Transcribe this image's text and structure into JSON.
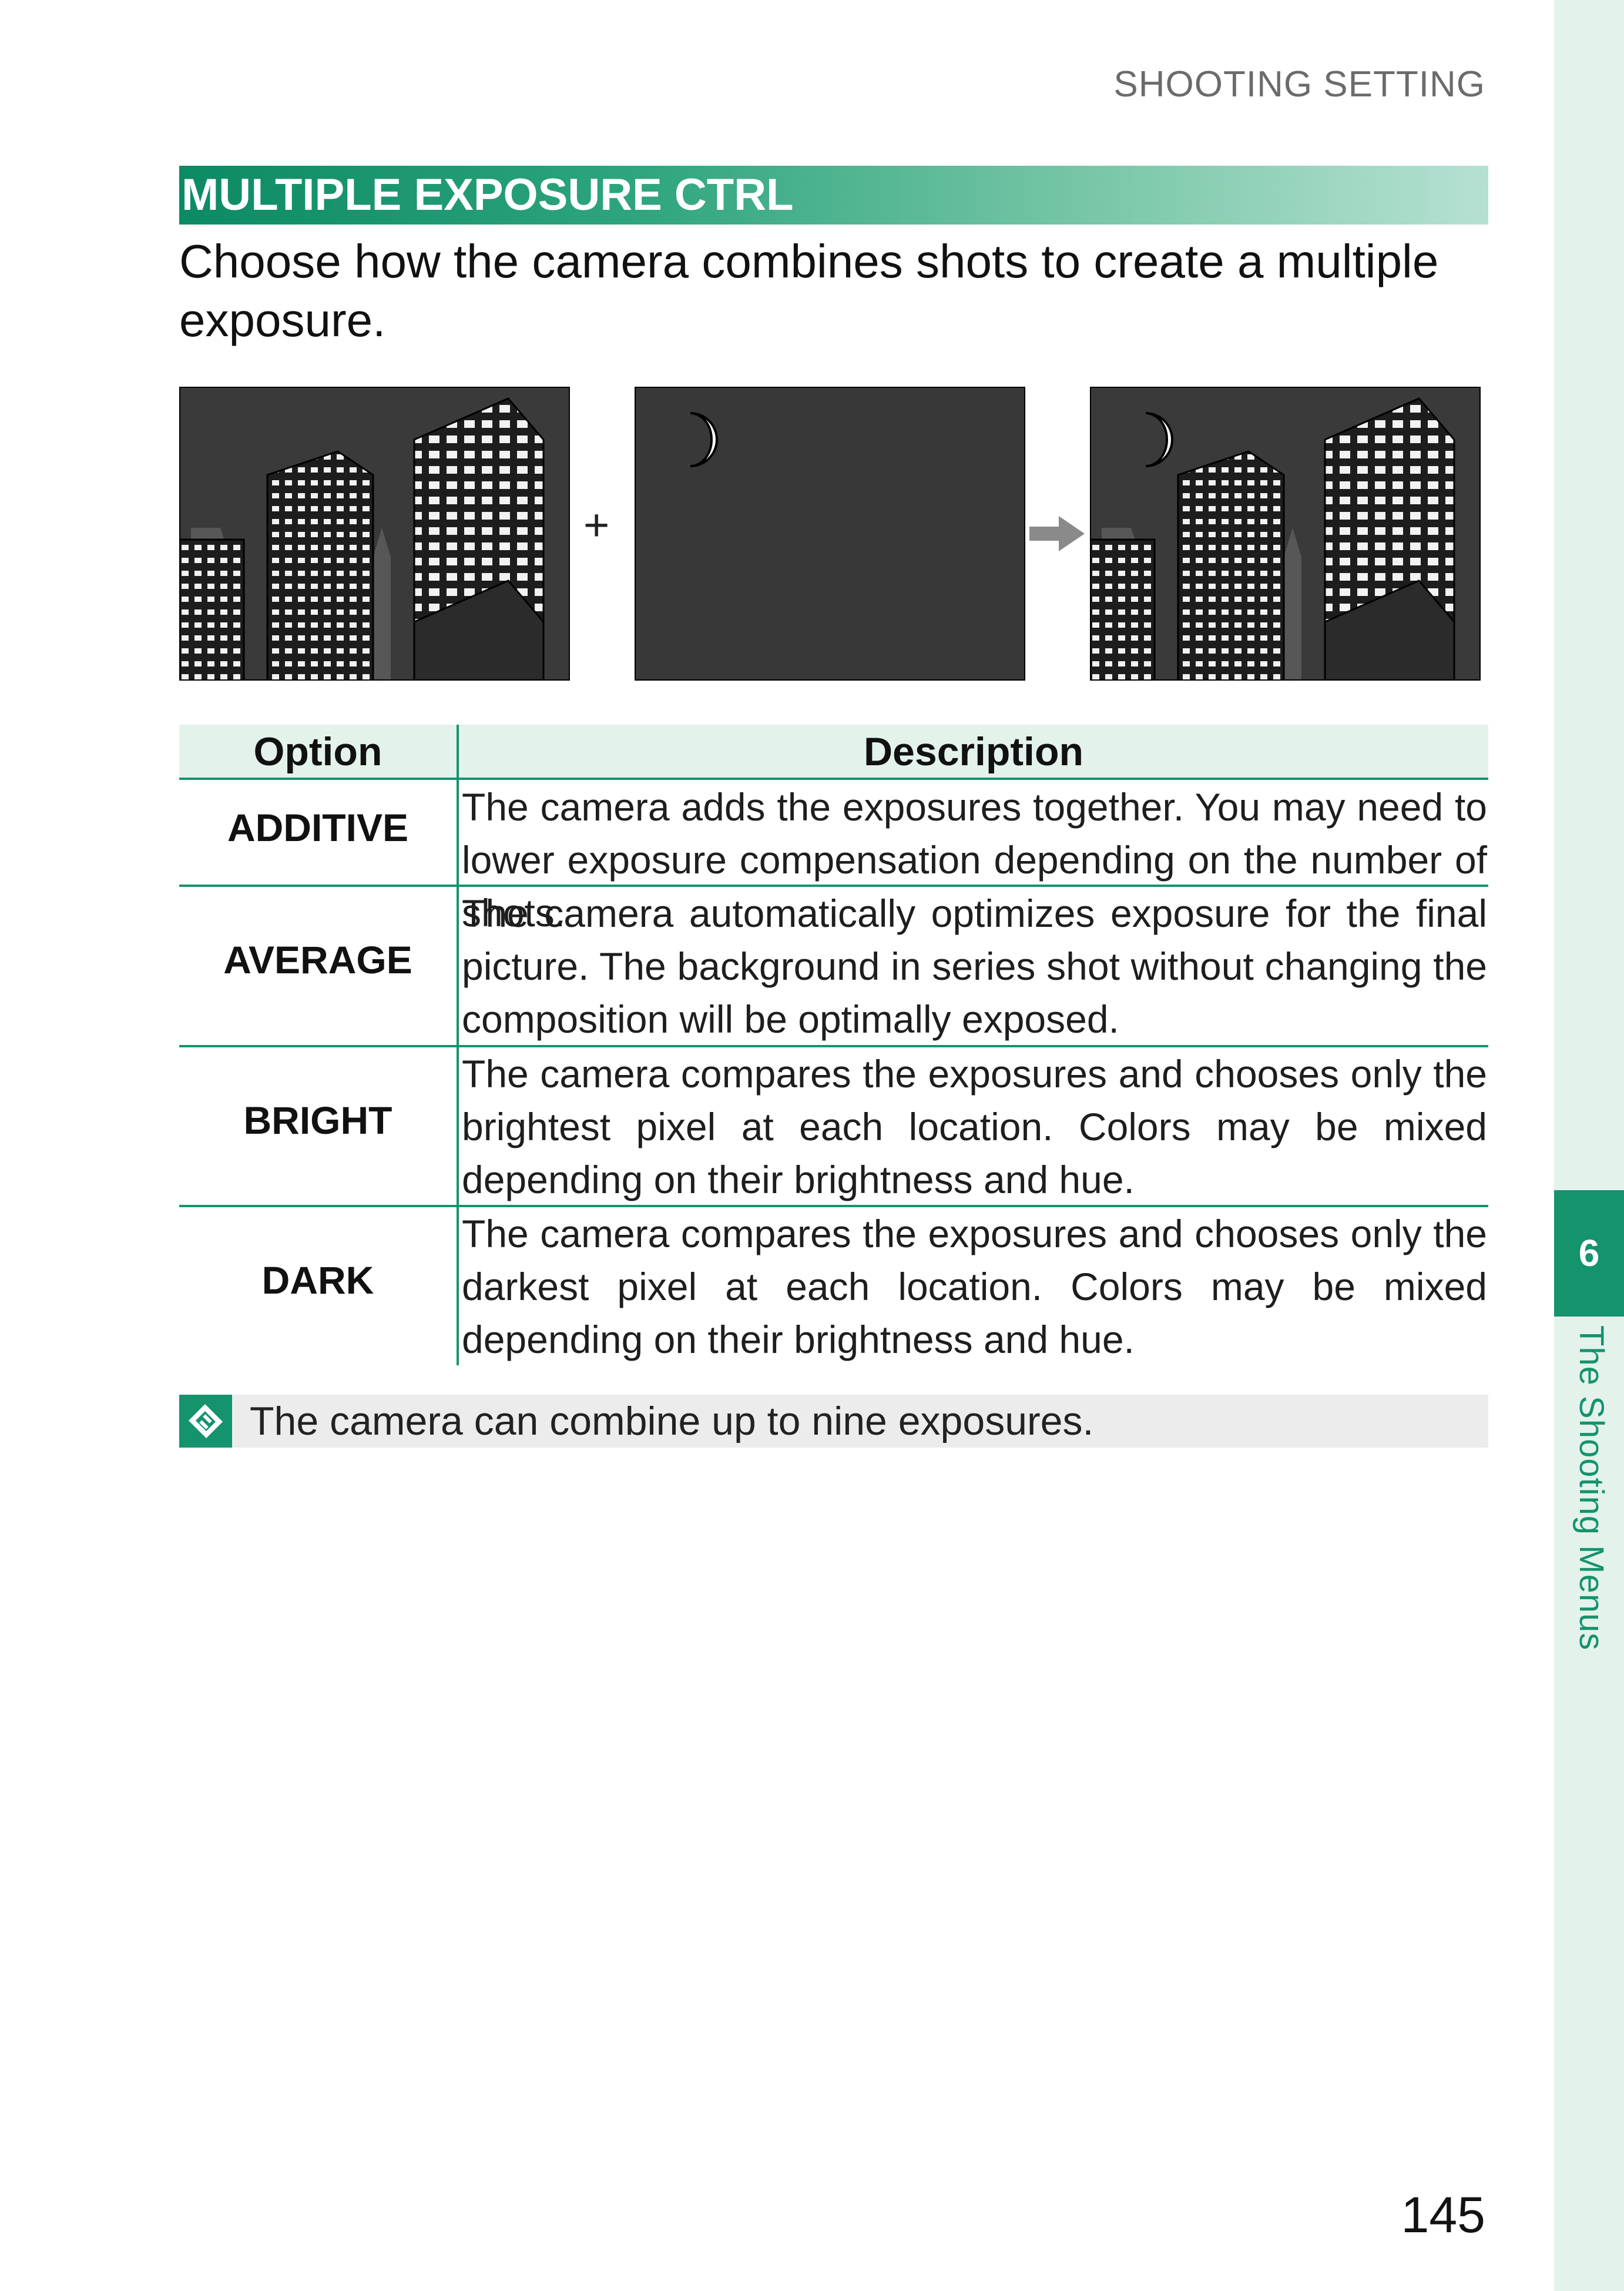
{
  "header": {
    "section": "SHOOTING SETTING"
  },
  "heading": {
    "title": "MULTIPLE EXPOSURE CTRL"
  },
  "intro": {
    "text": "Choose how the camera combines shots to create a multiple exposure."
  },
  "illustration": {
    "plus": "+",
    "icons": [
      "city-skyline-image",
      "moon-night-image",
      "arrow-right-icon",
      "combined-exposure-image"
    ]
  },
  "table": {
    "headers": {
      "option": "Option",
      "description": "Description"
    },
    "rows": [
      {
        "option": "ADDITIVE",
        "description": "The camera adds the exposures together. You may need to lower exposure compensation depending on the number of shots."
      },
      {
        "option": "AVERAGE",
        "description": "The camera automatically optimizes exposure for the final picture. The background in series shot without changing the composition will be optimally exposed."
      },
      {
        "option": "BRIGHT",
        "description": "The camera compares the exposures and chooses only the brightest pixel at each location. Colors may be mixed depending on their brightness and hue."
      },
      {
        "option": "DARK",
        "description": "The camera compares the exposures and chooses only the darkest pixel at each location. Colors may be mixed depending on their brightness and hue."
      }
    ]
  },
  "note": {
    "icon": "note-icon",
    "text": "The camera can combine up to nine exposures."
  },
  "sidebar": {
    "chapter_number": "6",
    "chapter_title": "The Shooting Menus"
  },
  "footer": {
    "page_number": "145"
  },
  "colors": {
    "accent": "#14936d",
    "tint": "#e4f2ec",
    "note_bg": "#ececec"
  }
}
